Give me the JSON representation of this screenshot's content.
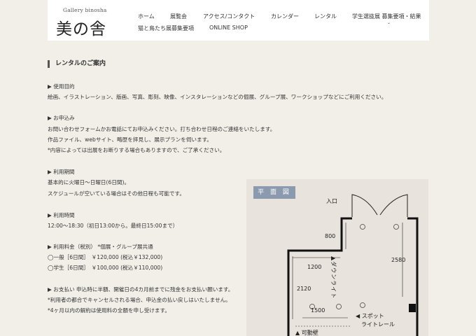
{
  "header": {
    "logo_small": "Gallery binosha",
    "logo_big": "美の舎",
    "nav": [
      {
        "label": "ホーム"
      },
      {
        "label": "展覧会"
      },
      {
        "label": "アクセス/コンタクト"
      },
      {
        "label": "カレンダー"
      },
      {
        "label": "レンタル"
      },
      {
        "label": "学生選抜展 募集要項・結果"
      },
      {
        "label": "猫と鳥たち展募集要項"
      },
      {
        "label": "ONLINE SHOP"
      }
    ]
  },
  "main": {
    "title": "レンタルのご案内",
    "lines": [
      "▶ 使用目的",
      "絵画、イラストレーション、版画、写真、彫刻、映像、インスタレーションなどの個展、グループ展、ワークショップなどにご利用ください。",
      "▶ お申込み",
      "お問い合わせフォームかお電話にてお申込みください。打ち合わせ日程のご連絡をいたします。",
      "作品ファイル、webサイト、略歴を拝見し、展示プランを伺います。",
      "*内容によっては出展をお断りする場合もありますので、ご了承ください。",
      "▶ 利用期間",
      "基本的に火曜日～日曜日(6日間)。",
      "スケジュールが空いている場合はその他日程も可能です。",
      "▶ 利用時間",
      "12:00～18:30（初日13:00から。最終日15:00まで）",
      "▶ 利用料金（税別） *個展・グループ展共通",
      "◯一般［6日間］　￥120,000 (税込￥132,000)",
      "◯学生［6日間］　￥100,000 (税込￥110,000)",
      "▶ お支払い 申込時に半額、開催日の4カ月前までに残金をお支払い願います。",
      "*利用者の都合でキャンセルされる場合、申込金の払い戻しはいたしません。",
      "*4ヶ月以内の解約は使用料の全額を申し受けます。"
    ]
  },
  "floorplan": {
    "label": "平 面 図",
    "entrance": "入口",
    "dim_800": "800",
    "dim_2580": "2580",
    "dim_1200": "1200",
    "dim_2120": "2120",
    "dim_1500": "1500",
    "downlight": "▲ダウンライト",
    "spot1": "◀ スポット",
    "spot2": "ライトレール",
    "movable_wall": "▲ 可動壁"
  }
}
